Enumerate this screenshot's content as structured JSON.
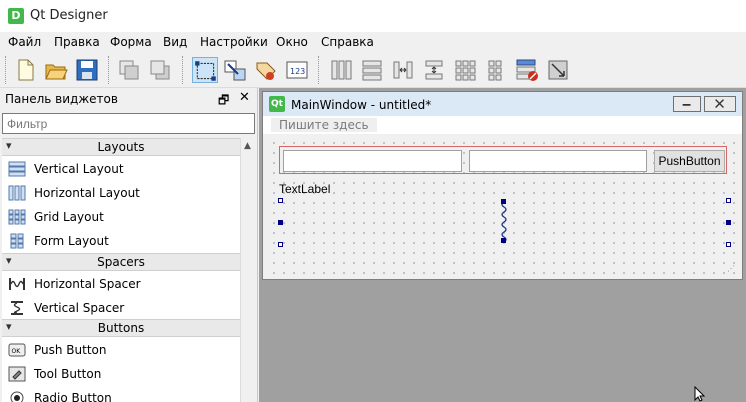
{
  "app": {
    "icon_letter": "D",
    "title": "Qt Designer"
  },
  "menu": [
    "Файл",
    "Правка",
    "Форма",
    "Вид",
    "Настройки",
    "Окно",
    "Справка"
  ],
  "toolbar_icons": [
    "new-file-icon",
    "open-file-icon",
    "save-icon",
    "send-to-back-icon",
    "bring-to-front-icon",
    "edit-widgets-icon",
    "edit-signals-slots-icon",
    "edit-buddies-icon",
    "edit-tab-order-icon",
    "layout-horizontal-icon",
    "layout-vertical-icon",
    "layout-horizontal-splitter-icon",
    "layout-vertical-splitter-icon",
    "layout-grid-icon",
    "layout-form-icon",
    "break-layout-icon",
    "adjust-size-icon"
  ],
  "widget_box": {
    "title": "Панель виджетов",
    "float_glyph": "🗗",
    "close_glyph": "✕",
    "filter_placeholder": "Фильтр",
    "categories": [
      {
        "label": "Layouts",
        "items": [
          {
            "label": "Vertical Layout",
            "icon": "vertical-layout-icon"
          },
          {
            "label": "Horizontal Layout",
            "icon": "horizontal-layout-icon"
          },
          {
            "label": "Grid Layout",
            "icon": "grid-layout-icon"
          },
          {
            "label": "Form Layout",
            "icon": "form-layout-icon"
          }
        ]
      },
      {
        "label": "Spacers",
        "items": [
          {
            "label": "Horizontal Spacer",
            "icon": "horizontal-spacer-icon"
          },
          {
            "label": "Vertical Spacer",
            "icon": "vertical-spacer-icon"
          }
        ]
      },
      {
        "label": "Buttons",
        "items": [
          {
            "label": "Push Button",
            "icon": "push-button-icon"
          },
          {
            "label": "Tool Button",
            "icon": "tool-button-icon"
          },
          {
            "label": "Radio Button",
            "icon": "radio-button-icon"
          }
        ]
      }
    ]
  },
  "form_window": {
    "qt_icon_text": "Qt",
    "title": "MainWindow - untitled*",
    "menu_placeholder": "Пишите здесь",
    "line_edit_1_value": "",
    "line_edit_2_value": "",
    "push_button_label": "PushButton",
    "text_label": "TextLabel"
  }
}
